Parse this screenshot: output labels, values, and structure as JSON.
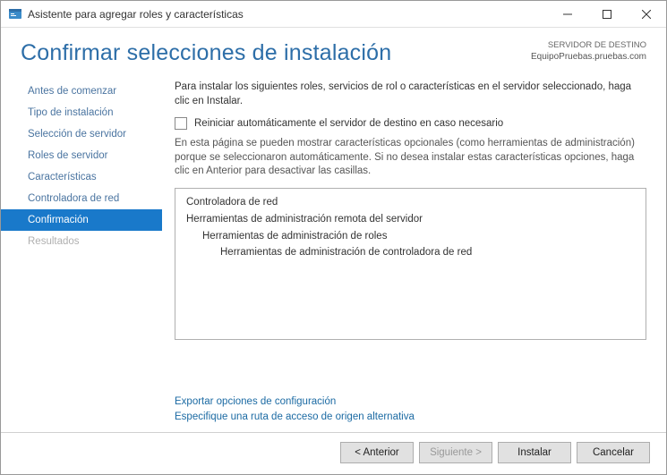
{
  "window": {
    "title": "Asistente para agregar roles y características"
  },
  "header": {
    "title": "Confirmar selecciones de instalación",
    "dest_label": "SERVIDOR DE DESTINO",
    "dest_value": "EquipoPruebas.pruebas.com"
  },
  "sidebar": {
    "items": [
      {
        "label": "Antes de comenzar",
        "state": "normal"
      },
      {
        "label": "Tipo de instalación",
        "state": "normal"
      },
      {
        "label": "Selección de servidor",
        "state": "normal"
      },
      {
        "label": "Roles de servidor",
        "state": "normal"
      },
      {
        "label": "Características",
        "state": "normal"
      },
      {
        "label": "Controladora de red",
        "state": "normal"
      },
      {
        "label": "Confirmación",
        "state": "active"
      },
      {
        "label": "Resultados",
        "state": "disabled"
      }
    ]
  },
  "main": {
    "intro": "Para instalar los siguientes roles, servicios de rol o características en el servidor seleccionado, haga clic en Instalar.",
    "restart_checkbox": "Reiniciar automáticamente el servidor de destino en caso necesario",
    "note": "En esta página se pueden mostrar características opcionales (como herramientas de administración) porque se seleccionaron automáticamente. Si no desea instalar estas características opciones, haga clic en Anterior para desactivar las casillas.",
    "tree": [
      {
        "level": 0,
        "text": "Controladora de red"
      },
      {
        "level": 0,
        "text": "Herramientas de administración remota del servidor"
      },
      {
        "level": 1,
        "text": "Herramientas de administración de roles"
      },
      {
        "level": 2,
        "text": "Herramientas de administración de controladora de red"
      }
    ],
    "links": {
      "export": "Exportar opciones de configuración",
      "altpath": "Especifique una ruta de acceso de origen alternativa"
    }
  },
  "footer": {
    "prev": "< Anterior",
    "next": "Siguiente >",
    "install": "Instalar",
    "cancel": "Cancelar"
  }
}
